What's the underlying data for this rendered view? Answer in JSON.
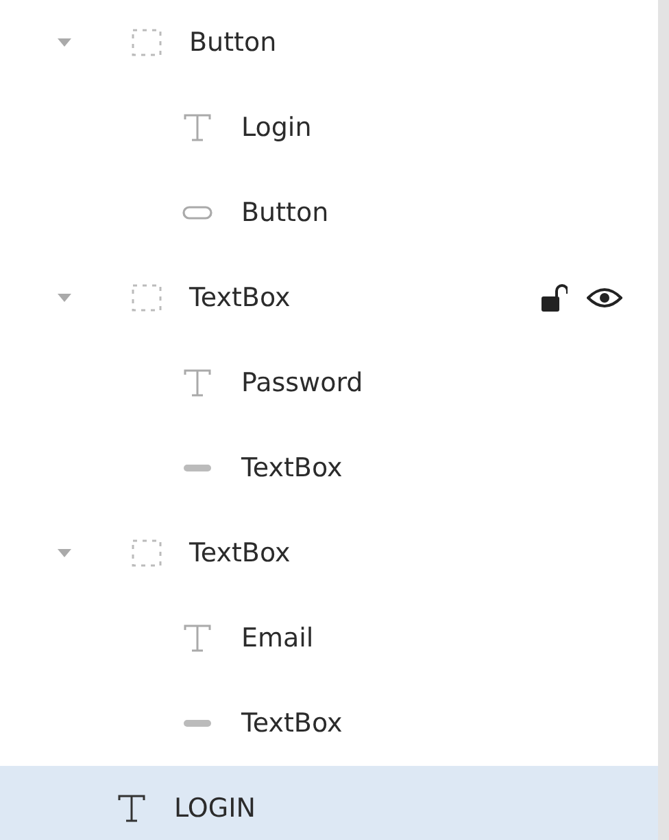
{
  "layers": [
    {
      "kind": "group",
      "name": "Button",
      "expanded": true,
      "selected": false,
      "hovered": false,
      "children": [
        {
          "kind": "text",
          "name": "Login",
          "selected": false
        },
        {
          "kind": "button",
          "name": "Button",
          "selected": false
        }
      ]
    },
    {
      "kind": "group",
      "name": "TextBox",
      "expanded": true,
      "selected": false,
      "hovered": true,
      "locked": false,
      "visible": true,
      "children": [
        {
          "kind": "text",
          "name": "Password",
          "selected": false
        },
        {
          "kind": "textbox",
          "name": "TextBox",
          "selected": false
        }
      ]
    },
    {
      "kind": "group",
      "name": "TextBox",
      "expanded": true,
      "selected": false,
      "hovered": false,
      "children": [
        {
          "kind": "text",
          "name": "Email",
          "selected": false
        },
        {
          "kind": "textbox",
          "name": "TextBox",
          "selected": false
        }
      ]
    },
    {
      "kind": "text",
      "name": "LOGIN",
      "selected": true
    }
  ]
}
